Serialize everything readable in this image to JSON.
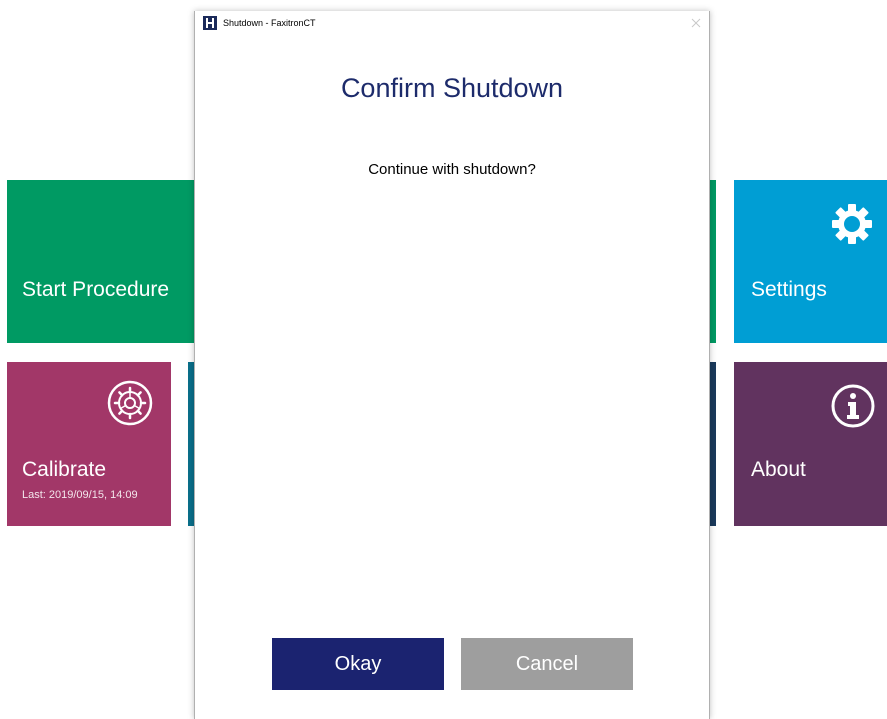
{
  "tiles": {
    "start_procedure": {
      "label": "Start Procedure",
      "color": "#009a63"
    },
    "settings": {
      "label": "Settings",
      "color": "#009ed4",
      "icon": "gear-icon"
    },
    "calibrate": {
      "label": "Calibrate",
      "sublabel": "Last: 2019/09/15, 14:09",
      "color": "#a23768",
      "icon": "calibrate-gear-circle-icon"
    },
    "about": {
      "label": "About",
      "color": "#61335f",
      "icon": "info-icon"
    }
  },
  "dialog": {
    "window_title": "Shutdown - FaxitronCT",
    "heading": "Confirm Shutdown",
    "message": "Continue with shutdown?",
    "okay_label": "Okay",
    "cancel_label": "Cancel",
    "heading_color": "#1d2b6b",
    "okay_color": "#1b2370",
    "cancel_color": "#9e9e9e"
  }
}
